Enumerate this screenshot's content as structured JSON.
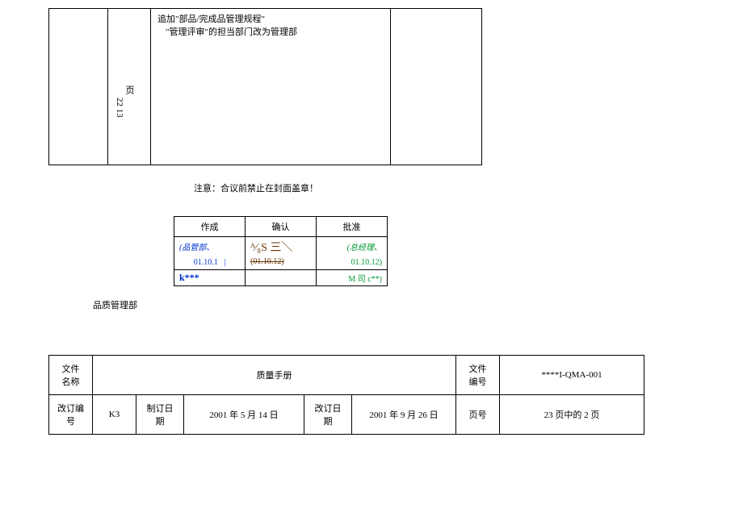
{
  "topTable": {
    "pageLabel": "页",
    "pageNums": "22 13",
    "line1": "追加\"部品/完成品管理规程\"",
    "line2": "\"管理评审\"的担当部门改为管理部"
  },
  "notice": "注意：合议前禁止在封面盖章！",
  "approval": {
    "headers": [
      "作成",
      "确认",
      "批准"
    ],
    "row1": {
      "c1": "(品管部、",
      "c2": "ᴬ⁄₈S 三＼",
      "c3": "(总经理、"
    },
    "row2": {
      "c1": "01.10.1",
      "c1b": "|",
      "c2": "(01.10.12)",
      "c3": "01.10.12)"
    },
    "row3": {
      "c1": "k***",
      "c3": "M 司 c**)"
    }
  },
  "deptLabel": "品质管理部",
  "bottom": {
    "docNameLabel": "文件\n名称",
    "docName": "质量手册",
    "docNoLabel": "文件\n编号",
    "docNo": "****I-QMA-001",
    "revNoLabel": "改订编\n号",
    "revNo": "K3",
    "createDateLabel": "制订日\n期",
    "createDate": "2001 年 5 月 14 日",
    "revDateLabel": "改订日\n期",
    "revDate": "2001 年 9 月 26 日",
    "pageLabel": "页号",
    "pageVal": "23 页中的 2 页"
  }
}
